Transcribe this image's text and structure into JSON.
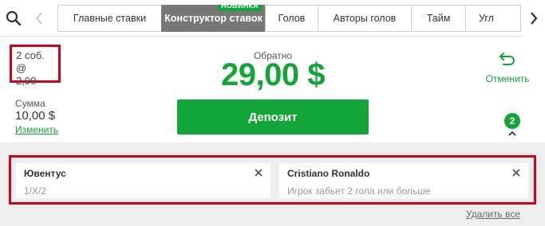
{
  "colors": {
    "accent": "#13a538",
    "highlight_border": "#d0021b",
    "active_tab_bg": "#777777",
    "panel_bg": "#eeeeee"
  },
  "icons": {
    "search": "search-icon",
    "prev": "chevron-left-icon",
    "next": "chevron-right-icon",
    "cancel": "undo-arrow-icon",
    "collapse": "chevron-up-icon",
    "remove": "close-icon"
  },
  "tabs": [
    {
      "label": "Главные ставки",
      "active": false
    },
    {
      "label": "Конструктор ставок",
      "active": true,
      "badge": "НОВИНКА"
    },
    {
      "label": "Голов",
      "active": false
    },
    {
      "label": "Авторы голов",
      "active": false
    },
    {
      "label": "Тайм",
      "active": false
    },
    {
      "label": "Угл",
      "active": false
    }
  ],
  "slip": {
    "events_line": "2 соб. @",
    "odds": "2,90",
    "stake_label": "Сумма",
    "stake_value": "10,00 $",
    "change_label": "Изменить",
    "return_label": "Обратно",
    "return_value": "29,00 $",
    "deposit_label": "Депозит",
    "cancel_label": "Отменить",
    "selection_count": "2"
  },
  "selections": [
    {
      "title": "Ювентус",
      "subtitle": "1/X/2"
    },
    {
      "title": "Cristiano Ronaldo",
      "subtitle": "Игрок забьет 2 гола или больше"
    }
  ],
  "remove_all_label": "Удалить все"
}
